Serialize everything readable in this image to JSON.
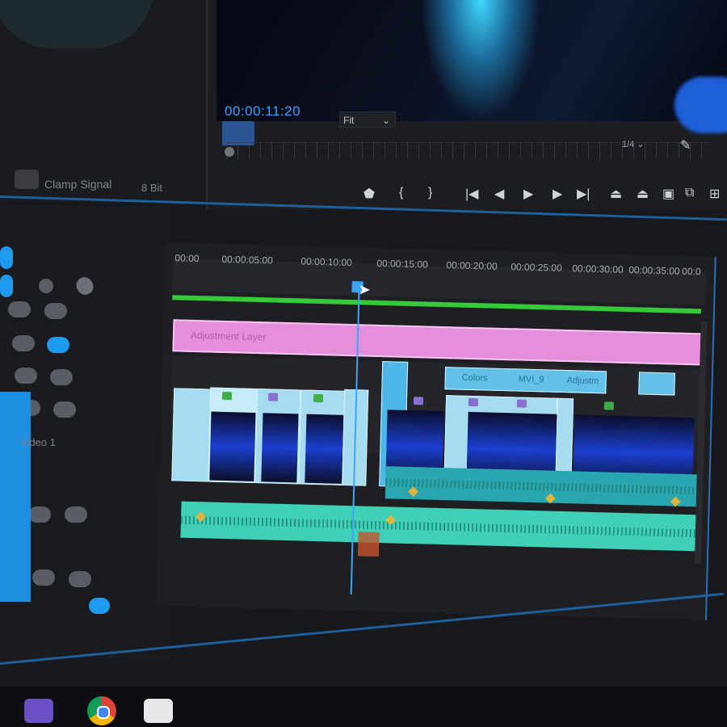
{
  "program_monitor": {
    "timecode": "00:00:11:20",
    "fit_label": "Fit",
    "resolution_label": "1/4",
    "transport_icons": [
      "marker-icon",
      "mark-in-icon",
      "mark-out-icon",
      "go-to-in-icon",
      "step-back-icon",
      "play-icon",
      "step-forward-icon",
      "go-to-out-icon",
      "lift-icon",
      "extract-icon",
      "export-frame-icon",
      "comparison-icon",
      "button-editor-icon"
    ]
  },
  "source_panel": {
    "clamp_label": "Clamp Signal",
    "bits_label": "8 Bit"
  },
  "tools_panel": {
    "track_label": "Video 1"
  },
  "timeline": {
    "timecodes": [
      "00:00",
      "00:00:05:00",
      "00:00:10:00",
      "00:00:15:00",
      "00:00:20:00",
      "00:00:25:00",
      "00:00:30:00",
      "00:00:35:00",
      "00:0"
    ],
    "title_clip_label": "Adjustment Layer",
    "clip_titles": [
      "Colors",
      "MVI_9",
      "Adjustm"
    ]
  },
  "colors": {
    "accent": "#3aa4ff",
    "title_track": "#e58fdc",
    "audio_track": "#3fd0b6",
    "work_area": "#36c93a"
  }
}
